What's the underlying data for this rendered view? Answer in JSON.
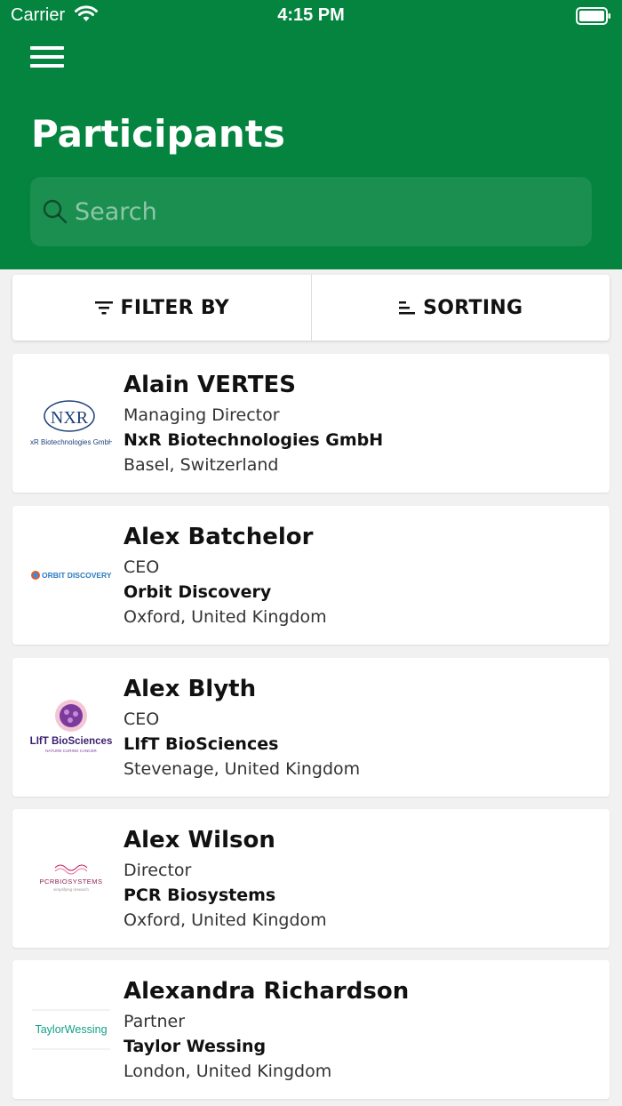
{
  "status_bar": {
    "carrier": "Carrier",
    "time": "4:15 PM"
  },
  "header": {
    "title": "Participants",
    "search": {
      "placeholder": "Search",
      "value": ""
    },
    "colors": {
      "brand": "#05843f"
    }
  },
  "toolbar": {
    "filter_label": "FILTER BY",
    "sorting_label": "SORTING"
  },
  "participants": [
    {
      "name": "Alain VERTES",
      "role": "Managing Director",
      "company": "NxR Biotechnologies GmbH",
      "location": "Basel, Switzerland",
      "logo": {
        "icon": "nxr-logo",
        "text": "NxR Biotechnologies GmbH",
        "mark": "NXR"
      }
    },
    {
      "name": "Alex Batchelor",
      "role": "CEO",
      "company": "Orbit Discovery",
      "location": "Oxford, United Kingdom",
      "logo": {
        "icon": "orbit-discovery-logo",
        "text": "ORBIT DISCOVERY"
      }
    },
    {
      "name": "Alex Blyth",
      "role": "CEO",
      "company": "LIfT BioSciences",
      "location": "Stevenage, United Kingdom",
      "logo": {
        "icon": "lift-biosciences-logo",
        "text": "LIfT BioSciences",
        "tagline": "NATURE CURING CANCER"
      }
    },
    {
      "name": "Alex Wilson",
      "role": "Director",
      "company": "PCR Biosystems",
      "location": "Oxford, United Kingdom",
      "logo": {
        "icon": "pcr-biosystems-logo",
        "text": "PCRBIOSYSTEMS",
        "tagline": "simplifying research"
      }
    },
    {
      "name": "Alexandra Richardson",
      "role": "Partner",
      "company": "Taylor Wessing",
      "location": "London, United Kingdom",
      "logo": {
        "icon": "taylor-wessing-logo",
        "text": "TaylorWessing"
      }
    }
  ]
}
